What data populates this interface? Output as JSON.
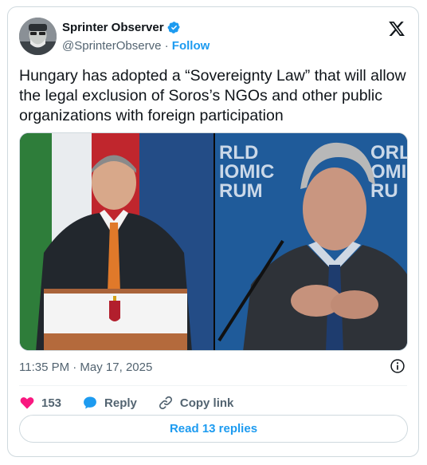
{
  "tweet": {
    "display_name": "Sprinter Observer",
    "handle": "@SprinterObserve",
    "separator": "·",
    "follow_label": "Follow",
    "text": "Hungary has adopted a “Sovereignty Law” that will allow the legal exclusion of Soros’s NGOs and other public organizations with foreign participation",
    "media_banner_left": "RLD\nIOMIC\nRUM",
    "media_banner_right": "ORL\nOMI\nRU",
    "timestamp": "11:35 PM · May 17, 2025",
    "like_count": "153",
    "reply_label": "Reply",
    "copy_link_label": "Copy link",
    "read_replies_label": "Read 13 replies"
  },
  "colors": {
    "accent": "#1d9bf0",
    "like": "#f91880",
    "text": "#0f1419",
    "muted": "#536471",
    "border": "#cfd9de"
  },
  "icons": [
    "verified-badge-icon",
    "x-logo-icon",
    "info-icon",
    "heart-icon",
    "reply-bubble-icon",
    "link-icon"
  ]
}
